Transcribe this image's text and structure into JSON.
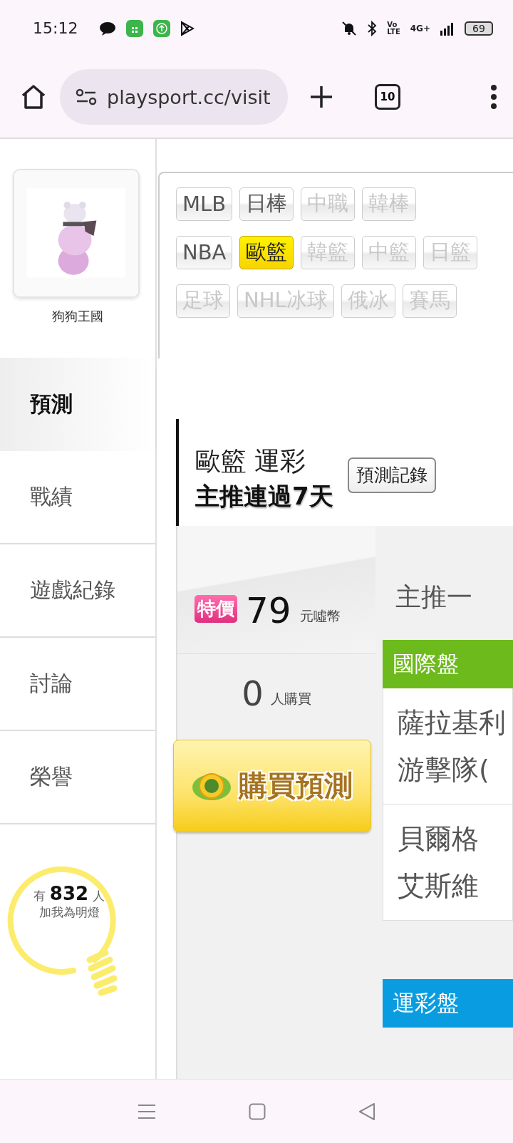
{
  "status_bar": {
    "time": "15:12",
    "volte_top": "Vo",
    "volte_bottom": "LTE",
    "network": "4G+",
    "battery": "69"
  },
  "browser": {
    "url": "playsport.cc/visit",
    "tab_count": "10"
  },
  "profile": {
    "name": "狗狗王國"
  },
  "sidebar": {
    "items": [
      {
        "label": "預測",
        "selected": true
      },
      {
        "label": "戰績",
        "selected": false
      },
      {
        "label": "遊戲紀錄",
        "selected": false
      },
      {
        "label": "討論",
        "selected": false
      },
      {
        "label": "榮譽",
        "selected": false
      }
    ]
  },
  "fans": {
    "prefix": "有",
    "count": "832",
    "suffix": "人",
    "caption": "加我為明燈"
  },
  "league_rows": [
    {
      "tags": [
        {
          "label": "MLB",
          "selected": false,
          "disabled": false
        },
        {
          "label": "日棒",
          "selected": false,
          "disabled": false
        },
        {
          "label": "中職",
          "selected": false,
          "disabled": true
        },
        {
          "label": "韓棒",
          "selected": false,
          "disabled": true
        }
      ]
    },
    {
      "tags": [
        {
          "label": "NBA",
          "selected": false,
          "disabled": false
        },
        {
          "label": "歐籃",
          "selected": true,
          "disabled": false
        },
        {
          "label": "韓籃",
          "selected": false,
          "disabled": true
        },
        {
          "label": "中籃",
          "selected": false,
          "disabled": true
        },
        {
          "label": "日籃",
          "selected": false,
          "disabled": true
        }
      ]
    },
    {
      "tags": [
        {
          "label": "足球",
          "selected": false,
          "disabled": true
        },
        {
          "label": "NHL冰球",
          "selected": false,
          "disabled": true
        },
        {
          "label": "俄冰",
          "selected": false,
          "disabled": true
        },
        {
          "label": "賽馬",
          "selected": false,
          "disabled": true
        }
      ]
    }
  ],
  "header": {
    "title": "歐籃 運彩",
    "streak": "主推連過7天",
    "record_button": "預測記錄"
  },
  "offer": {
    "badge": "特價",
    "price": "79",
    "unit": "元噓幣",
    "buyers": "0",
    "buyers_label": "人購買",
    "buy_button": "購買預測"
  },
  "main_pick": {
    "title": "主推一"
  },
  "sections": [
    {
      "title": "國際盤",
      "color": "#6dba1c",
      "games": [
        {
          "lines": [
            "薩拉基利",
            "游擊隊("
          ]
        },
        {
          "lines": [
            "貝爾格",
            "艾斯維"
          ]
        }
      ]
    },
    {
      "title": "運彩盤",
      "color": "#0a9ce0"
    }
  ]
}
